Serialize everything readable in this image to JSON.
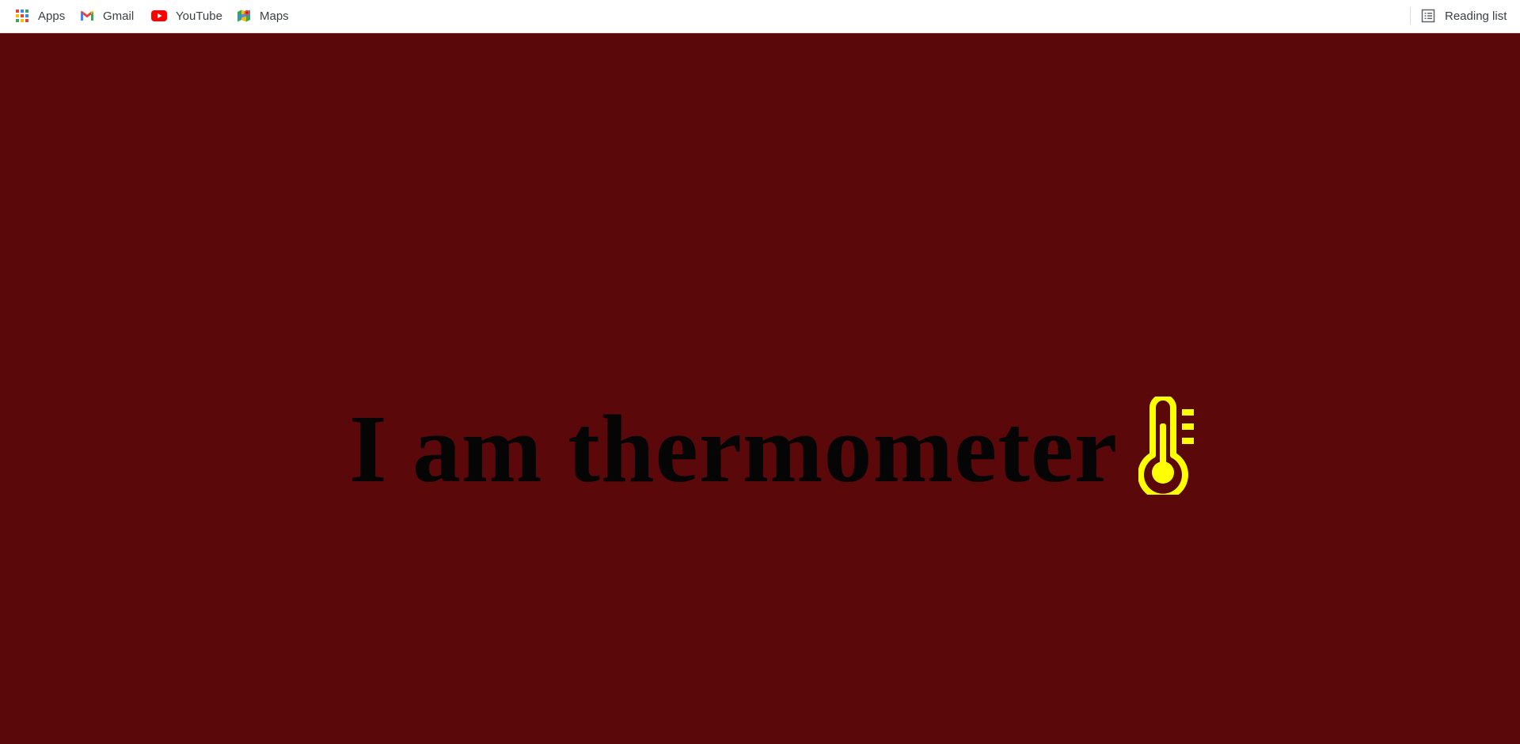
{
  "bookmarks_bar": {
    "items": [
      {
        "label": "Apps",
        "icon": "apps-grid-icon"
      },
      {
        "label": "Gmail",
        "icon": "gmail-icon"
      },
      {
        "label": "YouTube",
        "icon": "youtube-icon"
      },
      {
        "label": "Maps",
        "icon": "maps-icon"
      }
    ],
    "reading_list": {
      "label": "Reading list",
      "icon": "reading-list-icon"
    }
  },
  "page": {
    "background_color": "#5b080b",
    "heading": "I am thermometer",
    "heading_color": "#050505",
    "thermometer_icon": "thermometer-icon",
    "thermometer_color": "#ffff00"
  }
}
